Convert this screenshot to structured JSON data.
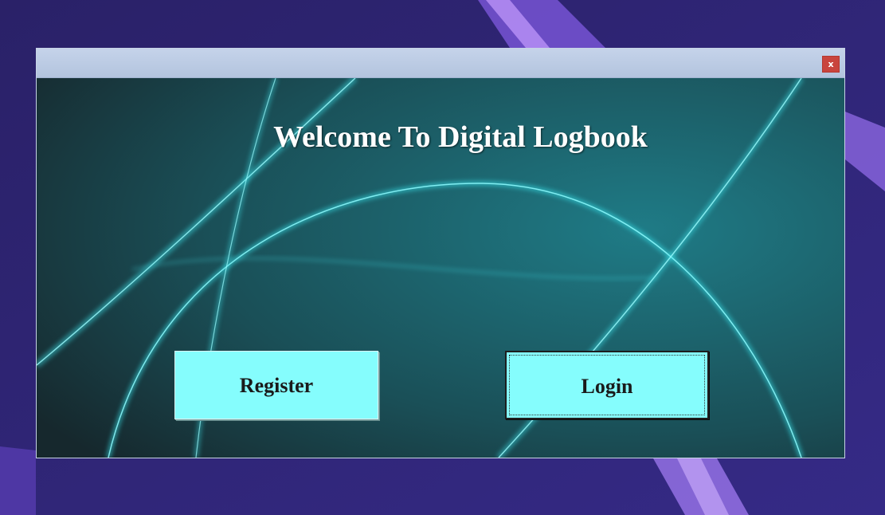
{
  "window": {
    "close_label": "x"
  },
  "main": {
    "title": "Welcome To Digital Logbook",
    "register_label": "Register",
    "login_label": "Login"
  },
  "colors": {
    "desktop_bg": "#2e2470",
    "titlebar": "#b9c9e2",
    "close_button": "#c9443d",
    "button_face": "#85fdfd",
    "title_text": "#ffffff"
  }
}
